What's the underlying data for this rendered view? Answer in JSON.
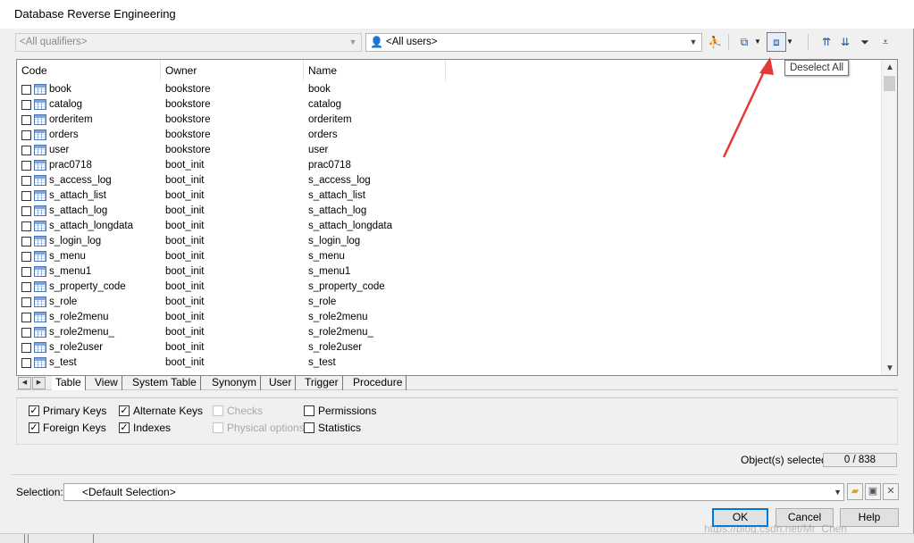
{
  "window": {
    "title": "Database Reverse Engineering"
  },
  "toolbar": {
    "qualifier_value": "<All qualifiers>",
    "user_value": "<All users>",
    "icons": [
      "user-icon",
      "select-all-icon",
      "deselect-all-icon",
      "move-top-icon",
      "move-bottom-icon",
      "filter-icon",
      "clear-filter-icon"
    ]
  },
  "tooltip": {
    "text": "Deselect All"
  },
  "annotation": {
    "arrow_color": "#e53935"
  },
  "list": {
    "columns": [
      "Code",
      "Owner",
      "Name"
    ],
    "rows": [
      {
        "code": "book",
        "owner": "bookstore",
        "name": "book"
      },
      {
        "code": "catalog",
        "owner": "bookstore",
        "name": "catalog"
      },
      {
        "code": "orderitem",
        "owner": "bookstore",
        "name": "orderitem"
      },
      {
        "code": "orders",
        "owner": "bookstore",
        "name": "orders"
      },
      {
        "code": "user",
        "owner": "bookstore",
        "name": "user"
      },
      {
        "code": "prac0718",
        "owner": "boot_init",
        "name": "prac0718"
      },
      {
        "code": "s_access_log",
        "owner": "boot_init",
        "name": "s_access_log"
      },
      {
        "code": "s_attach_list",
        "owner": "boot_init",
        "name": "s_attach_list"
      },
      {
        "code": "s_attach_log",
        "owner": "boot_init",
        "name": "s_attach_log"
      },
      {
        "code": "s_attach_longdata",
        "owner": "boot_init",
        "name": "s_attach_longdata"
      },
      {
        "code": "s_login_log",
        "owner": "boot_init",
        "name": "s_login_log"
      },
      {
        "code": "s_menu",
        "owner": "boot_init",
        "name": "s_menu"
      },
      {
        "code": "s_menu1",
        "owner": "boot_init",
        "name": "s_menu1"
      },
      {
        "code": "s_property_code",
        "owner": "boot_init",
        "name": "s_property_code"
      },
      {
        "code": "s_role",
        "owner": "boot_init",
        "name": "s_role"
      },
      {
        "code": "s_role2menu",
        "owner": "boot_init",
        "name": "s_role2menu"
      },
      {
        "code": "s_role2menu_",
        "owner": "boot_init",
        "name": "s_role2menu_"
      },
      {
        "code": "s_role2user",
        "owner": "boot_init",
        "name": "s_role2user"
      },
      {
        "code": "s_test",
        "owner": "boot_init",
        "name": "s_test"
      }
    ]
  },
  "tabs": [
    "Table",
    "View",
    "System Table",
    "Synonym",
    "User",
    "Trigger",
    "Procedure"
  ],
  "options": {
    "primary_keys": "Primary Keys",
    "foreign_keys": "Foreign Keys",
    "alternate_keys": "Alternate Keys",
    "indexes": "Indexes",
    "checks": "Checks",
    "physical_options": "Physical options",
    "permissions": "Permissions",
    "statistics": "Statistics"
  },
  "status": {
    "label": "Object(s) selected:",
    "value": "0 / 838"
  },
  "selection": {
    "label": "Selection:",
    "value": "<Default Selection>"
  },
  "buttons": {
    "ok": "OK",
    "cancel": "Cancel",
    "help": "Help"
  },
  "watermark": "https://blog.csdn.net/Mr_Chen"
}
